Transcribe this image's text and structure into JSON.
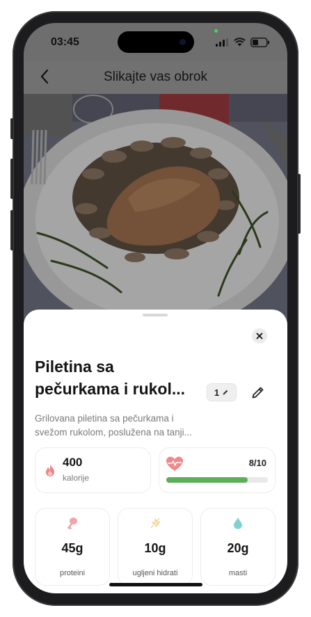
{
  "status_bar": {
    "time": "03:45"
  },
  "header": {
    "title": "Slikajte vas obrok"
  },
  "meal": {
    "title_line1": "Piletina sa",
    "title_line2": "pečurkama i rukol...",
    "quantity": "1",
    "description_line1": "Grilovana piletina sa pečurkama i",
    "description_line2": "svežom rukolom, poslužena na tanji..."
  },
  "calories": {
    "value": "400",
    "label": "kalorije"
  },
  "health_score": {
    "score": "8/10",
    "fraction": 0.8,
    "color": "#5cae59"
  },
  "macros": [
    {
      "value": "45g",
      "label": "proteini",
      "icon": "drumstick-icon",
      "color": "#f2a6a6"
    },
    {
      "value": "10g",
      "label": "ugljeni hidrati",
      "icon": "wheat-icon",
      "color": "#f4d9a0"
    },
    {
      "value": "20g",
      "label": "masti",
      "icon": "droplet-icon",
      "color": "#7fd3cf"
    }
  ]
}
